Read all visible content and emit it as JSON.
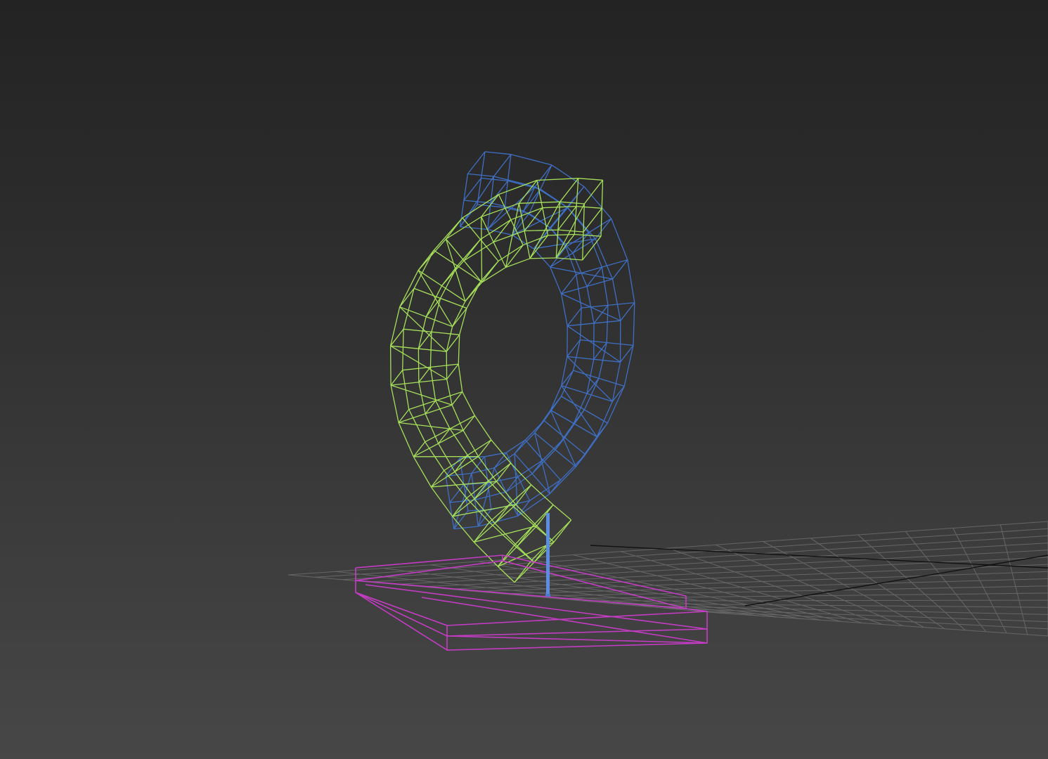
{
  "viewport": {
    "view": "perspective",
    "shading": "wireframe",
    "grid_visible": true
  },
  "objects": [
    {
      "name": "blue-bent-tube",
      "color": "#3f6fc4"
    },
    {
      "name": "green-bent-tube",
      "color": "#a6e05a"
    },
    {
      "name": "magenta-base-box",
      "color": "#c43cc4"
    },
    {
      "name": "blue-pivot-post",
      "color": "#5b8ee0"
    }
  ],
  "colors": {
    "background_top": "#232323",
    "background_bottom": "#474747",
    "grid": "#6e6e6e",
    "grid_axis": "#111111"
  }
}
